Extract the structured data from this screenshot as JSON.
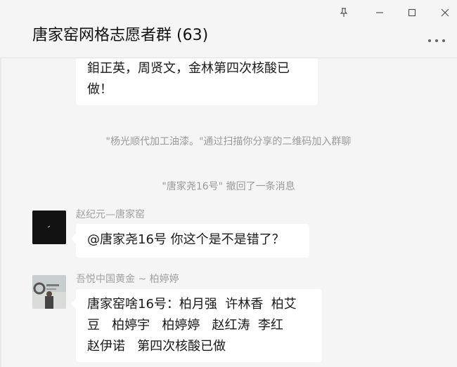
{
  "window": {
    "title": "唐家窑网格志愿者群 (63)",
    "controls": [
      "pin-icon",
      "minimize-icon",
      "maximize-icon",
      "close-icon"
    ],
    "more_icon": "more-dots-icon"
  },
  "messages": {
    "partial_bubble": {
      "line1": "鉬正英，周贤文，金林第四次核酸已",
      "line2": "做！"
    },
    "system1": "\"杨光顺代加工油漆。\"通过扫描你分享的二维码加入群聊",
    "system2": "\"唐家尧16号\" 撤回了一条消息",
    "msg1": {
      "sender": "赵纪元—唐家窑",
      "text": "@唐家尧16号 你这个是不是错了？",
      "avatar_icon": "dark-avatar-icon"
    },
    "msg2": {
      "sender": "吾悦中国黄金 ~ 柏婷婷",
      "line1": "唐家窑啥16号：柏月强  许林香  柏艾",
      "line2": "豆   柏婷宇   柏婷婷   赵红涛  李红",
      "line3": "赵伊诺   第四次核酸已做",
      "avatar_icon": "gold-store-avatar-icon"
    }
  },
  "colors": {
    "background": "#f5f5f5",
    "bubble": "#ffffff",
    "system_text": "#9a9a9a",
    "sender_text": "#a0a0a0"
  }
}
